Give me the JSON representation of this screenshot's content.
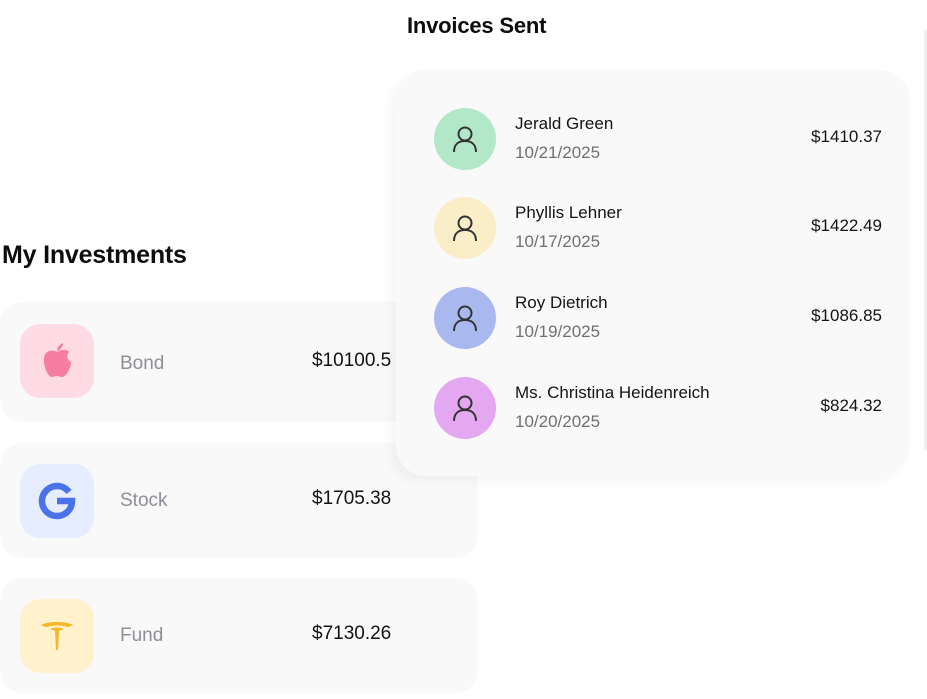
{
  "investments": {
    "title": "My Investments",
    "items": [
      {
        "type": "Bond",
        "amount": "$10100.5",
        "brand_icon": "apple-icon",
        "bg": "#ffdbe6",
        "fg": "#f67ea2"
      },
      {
        "type": "Stock",
        "amount": "$1705.38",
        "brand_icon": "google-icon",
        "bg": "#e5edff",
        "fg": "#4a73ea"
      },
      {
        "type": "Fund",
        "amount": "$7130.26",
        "brand_icon": "tesla-icon",
        "bg": "#fff2cc",
        "fg": "#f5b82a"
      }
    ]
  },
  "invoices": {
    "title": "Invoices Sent",
    "avatar_icon": "user-icon",
    "items": [
      {
        "name": "Jerald Green",
        "date": "10/21/2025",
        "amount": "$1410.37",
        "avatar_color": "#b2e8c8"
      },
      {
        "name": "Phyllis Lehner",
        "date": "10/17/2025",
        "amount": "$1422.49",
        "avatar_color": "#f9eec7"
      },
      {
        "name": "Roy Dietrich",
        "date": "10/19/2025",
        "amount": "$1086.85",
        "avatar_color": "#a9b9f0"
      },
      {
        "name": "Ms. Christina Heidenreich",
        "date": "10/20/2025",
        "amount": "$824.32",
        "avatar_color": "#e4a7f2"
      }
    ]
  }
}
